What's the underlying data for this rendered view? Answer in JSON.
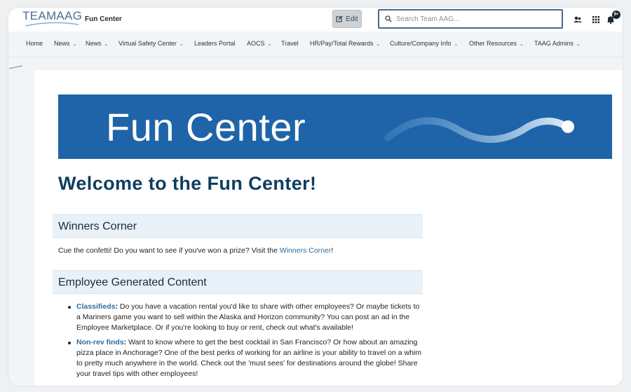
{
  "header": {
    "logo_text": "TEAMAAG",
    "site_title": "Fun Center",
    "edit_label": "Edit",
    "search_placeholder": "Search Team AAG...",
    "notifications_badge": "9+"
  },
  "nav": {
    "items": [
      {
        "label": "Home",
        "has_menu": false
      },
      {
        "label": "News",
        "has_menu": true
      },
      {
        "label": "News",
        "has_menu": true
      },
      {
        "label": "Virtual Safety Center",
        "has_menu": true
      },
      {
        "label": "Leaders Portal",
        "has_menu": false
      },
      {
        "label": "AOCS",
        "has_menu": true
      },
      {
        "label": "Travel",
        "has_menu": false
      },
      {
        "label": "HR/Pay/Total Rewards",
        "has_menu": true
      },
      {
        "label": "Culture/Company Info",
        "has_menu": true
      },
      {
        "label": "Other Resources",
        "has_menu": true
      },
      {
        "label": "TAAG Admins",
        "has_menu": true
      }
    ]
  },
  "banner": {
    "text": "Fun Center"
  },
  "page": {
    "welcome": "Welcome to the Fun Center!",
    "winners": {
      "heading": "Winners Corner",
      "text_before": "Cue the confetti! Do you want to see if you've won a prize? Visit the ",
      "link": "Winners Corner",
      "text_after": "!"
    },
    "employee": {
      "heading": "Employee Generated Content",
      "items": [
        {
          "title": "Classifieds",
          "text": " Do you have a vacation rental you'd like to share with other employees? Or maybe tickets to a Mariners game you want to sell within the Alaska and Horizon community? You can post an ad in the Employee Marketplace. Or if you're looking to buy or rent, check out what's available!"
        },
        {
          "title": "Non-rev finds",
          "text": " Want to know where to get the best cocktail in San Francisco? Or how about an amazing pizza place in Anchorage? One of the best perks of working for an airline is your ability to travel on a whim to pretty much anywhere in the world. Check out the 'must sees' for destinations around the globe! Share your travel tips with other employees!"
        }
      ]
    }
  },
  "colors": {
    "banner_blue": "#1f64a8",
    "heading_navy": "#0f3e5e",
    "link_blue": "#2e6d9c",
    "section_bg": "#e8f1f8"
  },
  "icons": [
    "edit-icon",
    "search-icon",
    "people-icon",
    "apps-grid-icon",
    "bell-icon",
    "chevron-down-icon"
  ]
}
